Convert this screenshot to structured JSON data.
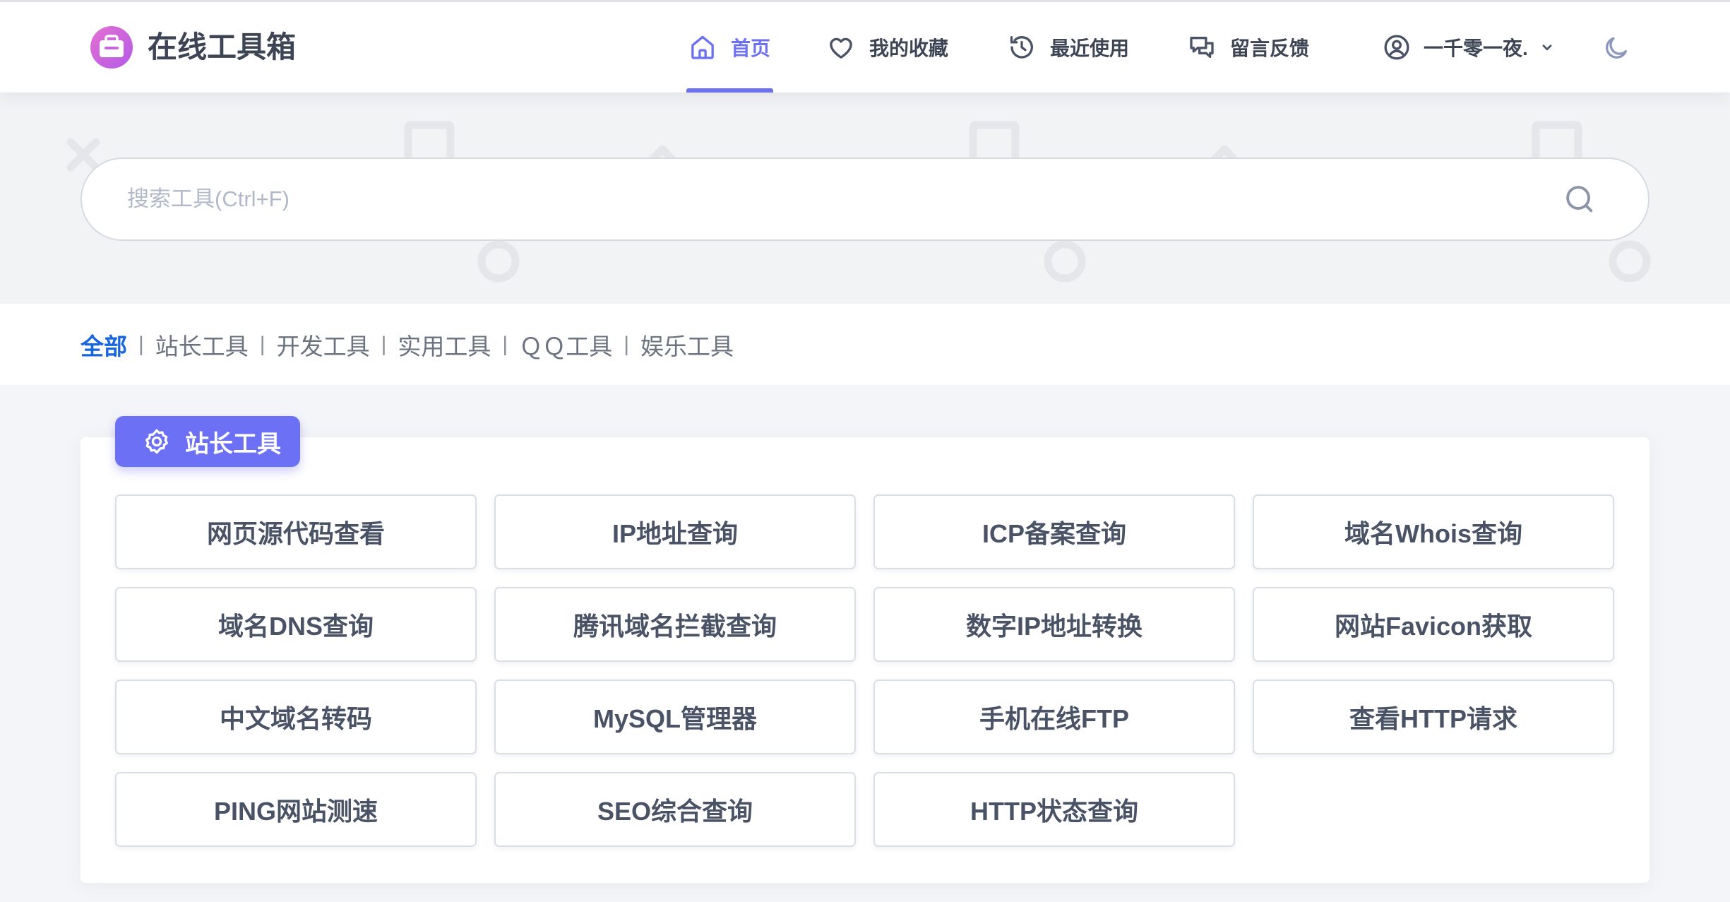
{
  "app": {
    "title": "在线工具箱",
    "logo_icon": "toolbox-icon"
  },
  "nav": {
    "items": [
      {
        "label": "首页",
        "icon": "home-icon",
        "active": true
      },
      {
        "label": "我的收藏",
        "icon": "heart-icon",
        "active": false
      },
      {
        "label": "最近使用",
        "icon": "history-icon",
        "active": false
      },
      {
        "label": "留言反馈",
        "icon": "chat-icon",
        "active": false
      }
    ],
    "user": {
      "name": "一千零一夜.",
      "icon": "user-circle-icon",
      "menu_icon": "chevron-down-icon"
    },
    "theme_toggle_icon": "moon-icon"
  },
  "search": {
    "placeholder": "搜索工具(Ctrl+F)",
    "value": "",
    "icon": "search-icon"
  },
  "categories": {
    "separator": "|",
    "items": [
      {
        "label": "全部",
        "active": true
      },
      {
        "label": "站长工具",
        "active": false
      },
      {
        "label": "开发工具",
        "active": false
      },
      {
        "label": "实用工具",
        "active": false
      },
      {
        "label": "ＱＱ工具",
        "active": false
      },
      {
        "label": "娱乐工具",
        "active": false
      }
    ]
  },
  "section": {
    "title": "站长工具",
    "icon": "gear-icon",
    "tools": [
      "网页源代码查看",
      "IP地址查询",
      "ICP备案查询",
      "域名Whois查询",
      "域名DNS查询",
      "腾讯域名拦截查询",
      "数字IP地址转换",
      "网站Favicon获取",
      "中文域名转码",
      "MySQL管理器",
      "手机在线FTP",
      "查看HTTP请求",
      "PING网站测速",
      "SEO综合查询",
      "HTTP状态查询"
    ]
  },
  "colors": {
    "accent": "#6c70f3",
    "active_category": "#1766e0",
    "logo_gradient_start": "#e46fd3",
    "logo_gradient_end": "#b45be6",
    "text_primary": "#3d4454",
    "page_background": "#f4f5f8"
  }
}
